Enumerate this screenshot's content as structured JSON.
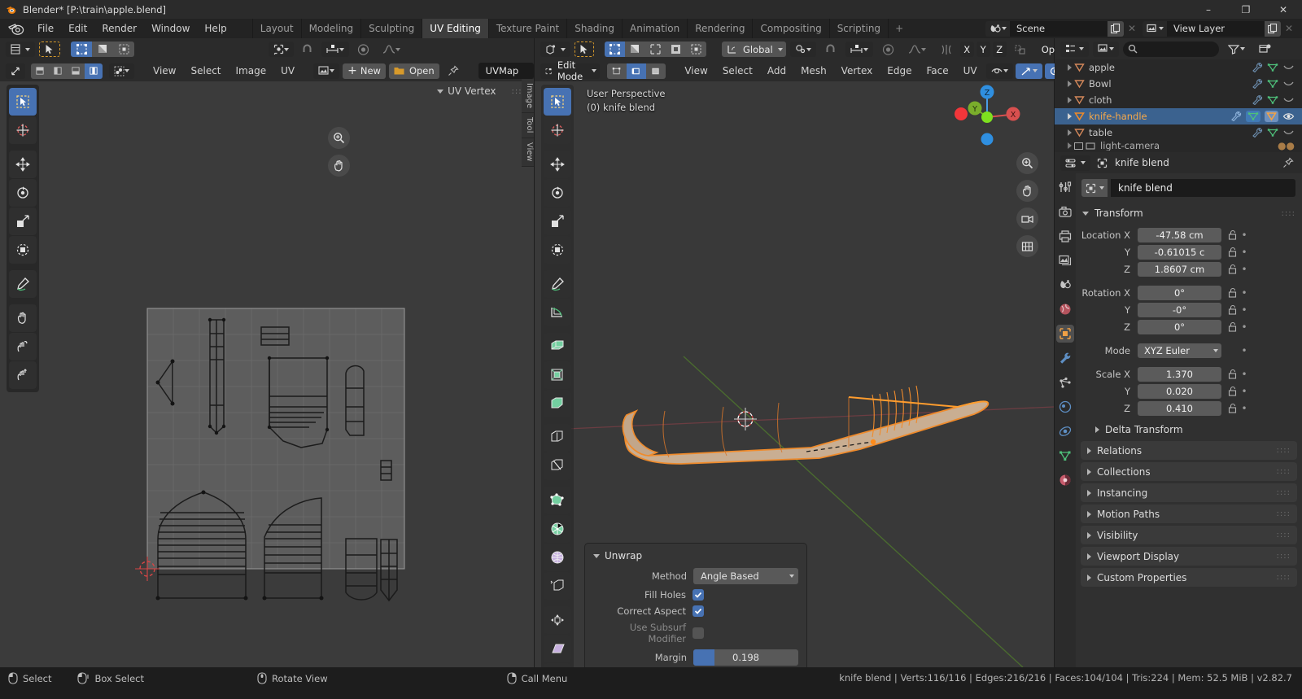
{
  "window": {
    "title": "Blender* [P:\\train\\apple.blend]",
    "minimize": "–",
    "maximize": "❐",
    "close": "✕"
  },
  "topbar": {
    "menus": [
      "File",
      "Edit",
      "Render",
      "Window",
      "Help"
    ],
    "workspaces": [
      {
        "label": "Layout",
        "active": false
      },
      {
        "label": "Modeling",
        "active": false
      },
      {
        "label": "Sculpting",
        "active": false
      },
      {
        "label": "UV Editing",
        "active": true
      },
      {
        "label": "Texture Paint",
        "active": false
      },
      {
        "label": "Shading",
        "active": false
      },
      {
        "label": "Animation",
        "active": false
      },
      {
        "label": "Rendering",
        "active": false
      },
      {
        "label": "Compositing",
        "active": false
      },
      {
        "label": "Scripting",
        "active": false
      }
    ],
    "add_workspace": "+",
    "scene": {
      "label": "Scene",
      "new_icon": "duplicate-icon",
      "x_icon": "✕"
    },
    "view_layer": {
      "label": "View Layer",
      "new_icon": "duplicate-icon",
      "x_icon": "✕"
    }
  },
  "uv_editor": {
    "menus": [
      "View",
      "Select",
      "Image",
      "UV"
    ],
    "new_button": "New",
    "open_button": "Open",
    "image_name": "UVMap",
    "uv_vertex_panel": "UV Vertex",
    "side_tabs": [
      "Image",
      "Tool",
      "View"
    ],
    "tools": [
      "tweak-tool",
      "cursor-tool",
      "move-tool",
      "rotate-tool",
      "scale-tool",
      "transform-tool",
      "annotate-tool",
      "grab-tool",
      "relax-tool",
      "pinch-tool"
    ],
    "select_modes": [
      "vertex-select",
      "edge-select",
      "face-select",
      "island-select"
    ],
    "pivot": "pivot-icon",
    "snap": "snap-icon",
    "proportional": "proportional-edit-icon",
    "pin_icon": "pin-icon"
  },
  "viewport": {
    "mode": "Edit Mode",
    "menus": [
      "View",
      "Select",
      "Add",
      "Mesh",
      "Vertex",
      "Edge",
      "Face",
      "UV"
    ],
    "transform_orientation": "Global",
    "options_button": "Options",
    "axis_locks": [
      "X",
      "Y",
      "Z"
    ],
    "overlay_text_line1": "User Perspective",
    "overlay_text_line2": "(0) knife blend",
    "gizmo_axes": {
      "x": "X",
      "y": "Y",
      "z": "Z"
    },
    "nav_buttons": [
      "zoom-icon",
      "pan-icon",
      "camera-icon",
      "ortho-persp-icon"
    ],
    "select_modes": [
      "vertex-select",
      "edge-select",
      "face-select"
    ],
    "shading_modes": [
      "wireframe-shading",
      "solid-shading",
      "material-shading",
      "rendered-shading"
    ],
    "tools": [
      "tweak-tool",
      "cursor-tool",
      "move-tool",
      "rotate-tool",
      "scale-tool",
      "transform-tool",
      "annotate-tool",
      "measure-tool",
      "extrude-region-tool",
      "inset-faces-tool",
      "bevel-tool",
      "loop-cut-tool",
      "knife-tool",
      "poly-build-tool",
      "spin-tool",
      "smooth-tool",
      "edge-slide-tool",
      "shrink-fatten-tool",
      "shear-tool",
      "rip-region-tool"
    ]
  },
  "unwrap_panel": {
    "title": "Unwrap",
    "method_label": "Method",
    "method_value": "Angle Based",
    "fill_holes_label": "Fill Holes",
    "fill_holes_checked": true,
    "correct_aspect_label": "Correct Aspect",
    "correct_aspect_checked": true,
    "use_subsurf_label": "Use Subsurf Modifier",
    "use_subsurf_checked": false,
    "margin_label": "Margin",
    "margin_value": "0.198",
    "margin_fill_pct": 19.8
  },
  "outliner": {
    "display_mode": "view-layer-icon",
    "filter_icon": "filter-icon",
    "new_collection_icon": "new-collection-icon",
    "search_placeholder": "",
    "rows": [
      {
        "name": "apple",
        "selected": false,
        "modifier_icon": "wrench-icon",
        "data_icon": "mesh-data-icon",
        "vis_icon": "hidden-eye-icon"
      },
      {
        "name": "Bowl",
        "selected": false,
        "modifier_icon": "wrench-icon",
        "data_icon": "mesh-data-icon",
        "vis_icon": "hidden-eye-icon"
      },
      {
        "name": "cloth",
        "selected": false,
        "modifier_icon": "wrench-icon",
        "data_icon": "mesh-data-icon",
        "vis_icon": "hidden-eye-icon"
      },
      {
        "name": "knife-handle",
        "selected": true,
        "modifier_icon": "wrench-icon",
        "data_icon": "mesh-data-icon",
        "vis_icon": "eye-icon"
      },
      {
        "name": "table",
        "selected": false,
        "modifier_icon": "wrench-icon",
        "data_icon": "mesh-data-icon",
        "vis_icon": "hidden-eye-icon"
      },
      {
        "name": "light-camera",
        "selected": false,
        "modifier_icon": "",
        "data_icon": "",
        "vis_icon": ""
      }
    ]
  },
  "properties": {
    "breadcrumb": "knife blend",
    "pin_icon": "pin-icon",
    "editor_type_icon": "properties-editor-icon",
    "object_name": "knife blend",
    "tabs": [
      {
        "name": "tool-tab",
        "active": false
      },
      {
        "name": "render-tab",
        "active": false
      },
      {
        "name": "output-tab",
        "active": false
      },
      {
        "name": "view-layer-tab",
        "active": false
      },
      {
        "name": "scene-tab",
        "active": false
      },
      {
        "name": "world-tab",
        "active": false
      },
      {
        "name": "object-tab",
        "active": true
      },
      {
        "name": "modifier-tab",
        "active": false
      },
      {
        "name": "particles-tab",
        "active": false
      },
      {
        "name": "physics-tab",
        "active": false
      },
      {
        "name": "constraint-tab",
        "active": false
      },
      {
        "name": "object-data-tab",
        "active": false
      },
      {
        "name": "material-tab",
        "active": false
      }
    ],
    "transform": {
      "title": "Transform",
      "location_label": "Location X",
      "location": [
        {
          "axis": "Location X",
          "value": "-47.58 cm"
        },
        {
          "axis": "Y",
          "value": "-0.61015 c"
        },
        {
          "axis": "Z",
          "value": "1.8607 cm"
        }
      ],
      "rotation": [
        {
          "axis": "Rotation X",
          "value": "0°"
        },
        {
          "axis": "Y",
          "value": "-0°"
        },
        {
          "axis": "Z",
          "value": "0°"
        }
      ],
      "mode_label": "Mode",
      "mode_value": "XYZ Euler",
      "scale": [
        {
          "axis": "Scale X",
          "value": "1.370"
        },
        {
          "axis": "Y",
          "value": "0.020"
        },
        {
          "axis": "Z",
          "value": "0.410"
        }
      ],
      "delta_transform": "Delta Transform"
    },
    "sections": [
      "Relations",
      "Collections",
      "Instancing",
      "Motion Paths",
      "Visibility",
      "Viewport Display",
      "Custom Properties"
    ]
  },
  "statusbar": {
    "keys": [
      {
        "icon": "mouse-left-icon",
        "label": "Select"
      },
      {
        "icon": "mouse-left-drag-icon",
        "label": "Box Select"
      },
      {
        "icon": "mouse-middle-icon",
        "label": "Rotate View"
      },
      {
        "icon": "mouse-right-icon",
        "label": "Call Menu"
      }
    ],
    "stats": "knife blend | Verts:116/116 | Edges:216/216 | Faces:104/104 | Tris:224 | Mem: 52.5 MiB | v2.82.7"
  },
  "colors": {
    "accent_blue": "#4772b3",
    "selected_orange": "#ed9335",
    "active_orange": "#ffa028",
    "mesh_green": "#4ec07a",
    "panel_bg": "#303030",
    "header_bg": "#2b2b2b",
    "viewport_bg": "#393939"
  }
}
